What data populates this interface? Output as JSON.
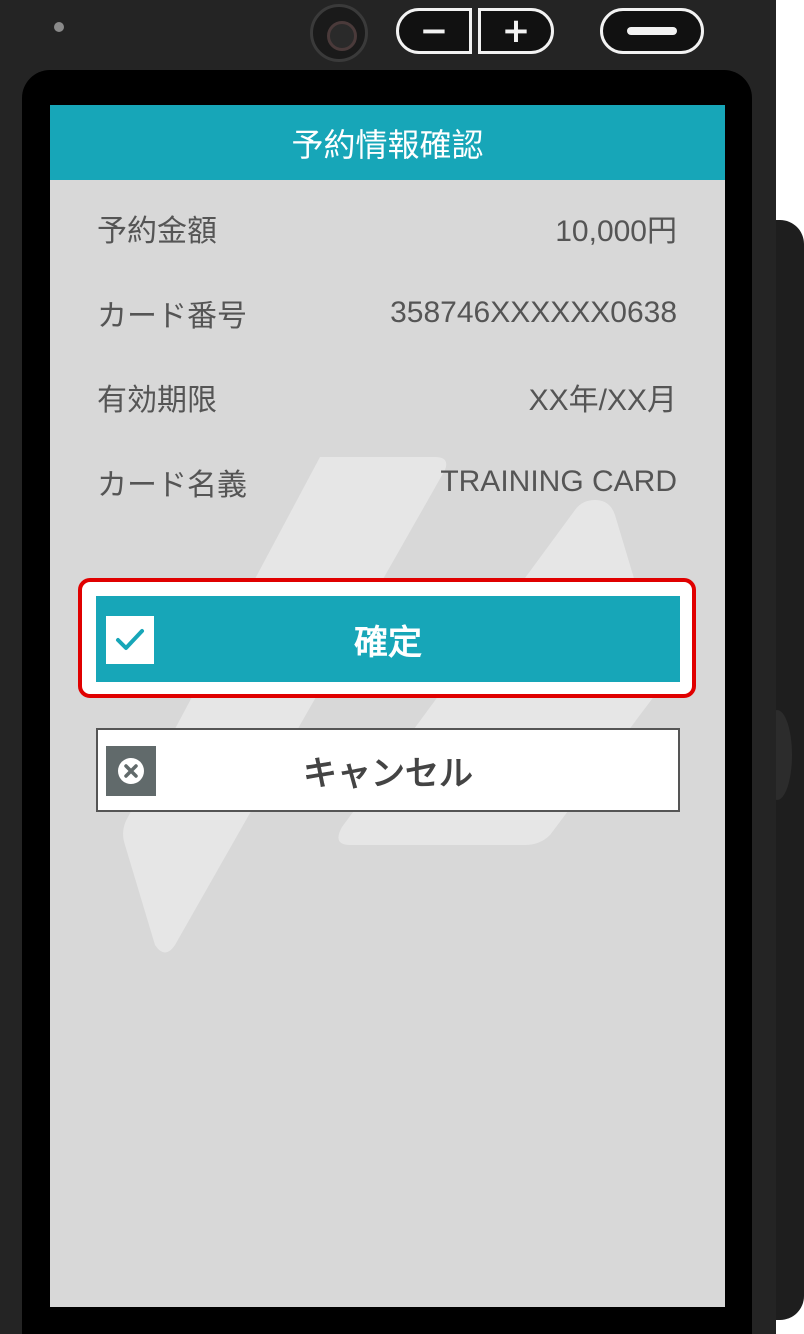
{
  "screen": {
    "title": "予約情報確認"
  },
  "details": [
    {
      "label": "予約金額",
      "value": "10,000円"
    },
    {
      "label": "カード番号",
      "value": "358746XXXXXX0638"
    },
    {
      "label": "有効期限",
      "value": "XX年/XX月"
    },
    {
      "label": "カード名義",
      "value": "TRAINING CARD"
    }
  ],
  "buttons": {
    "confirm_label": "確定",
    "cancel_label": "キャンセル"
  },
  "hardware": {
    "minus_label": "−",
    "plus_label": "+"
  },
  "colors": {
    "accent": "#17a6b8",
    "highlight": "#e00000",
    "screen_bg": "#d8d8d8"
  },
  "icons": {
    "confirm": "checkmark-icon",
    "cancel": "close-circle-icon"
  }
}
